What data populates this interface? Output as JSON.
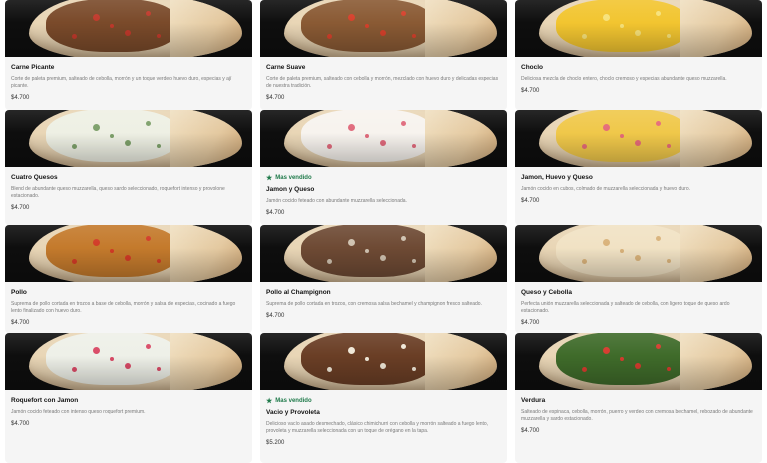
{
  "products": [
    {
      "name": "Carne Picante",
      "description": "Corte de paleta premium, salteado de cebolla, morrón y un toque verdeo huevo duro, especias y ají picante.",
      "price": "$4.700",
      "badge": "",
      "filling": "#7a4a2a",
      "accent": "#c0392b"
    },
    {
      "name": "Carne Suave",
      "description": "Corte de paleta premium, salteado con cebolla y morrón, mezclado con huevo duro y delicadas especias de nuestra tradición.",
      "price": "$4.700",
      "badge": "",
      "filling": "#8a5a34",
      "accent": "#d6402b"
    },
    {
      "name": "Choclo",
      "description": "Deliciosa mezcla de choclo entero, choclo cremoso y especias abundante queso muzzarella.",
      "price": "$4.700",
      "badge": "",
      "filling": "#f2c530",
      "accent": "#f7e27a"
    },
    {
      "name": "Cuatro Quesos",
      "description": "Blend de abundante queso muzzarella, queso sardo seleccionado, roquefort intenso y provolone estacionado.",
      "price": "$4.700",
      "badge": "",
      "filling": "#eef0e4",
      "accent": "#7da06a"
    },
    {
      "name": "Jamon y Queso",
      "description": "Jamón cocido feteado con abundante muzzarella seleccionada.",
      "price": "$4.700",
      "badge": "Mas vendido",
      "filling": "#f7f3ee",
      "accent": "#e06a7c"
    },
    {
      "name": "Jamon, Huevo y Queso",
      "description": "Jamón cocido en cubos, colmado de muzzarella seleccionada y huevo duro.",
      "price": "$4.700",
      "badge": "",
      "filling": "#f0c84a",
      "accent": "#e56b78"
    },
    {
      "name": "Pollo",
      "description": "Suprema de pollo cortada en trozos a base de cebolla, morrón y salsa de especias, cocinado a fuego lento finalizado con huevo duro.",
      "price": "$4.700",
      "badge": "",
      "filling": "#c47a2c",
      "accent": "#d13a26"
    },
    {
      "name": "Pollo al Champignon",
      "description": "Suprema de pollo cortada en trozos, con cremosa salsa bechamel y champignon fresco salteado.",
      "price": "$4.700",
      "badge": "",
      "filling": "#6e4a34",
      "accent": "#cfc2b0"
    },
    {
      "name": "Queso y Cebolla",
      "description": "Perfecta unión muzzarella seleccionada y salteado de cebolla, con ligero toque de queso ardo estacionado.",
      "price": "$4.700",
      "badge": "",
      "filling": "#f1e2c4",
      "accent": "#d9b27a"
    },
    {
      "name": "Roquefort con Jamon",
      "description": "Jamón cocido feteado con intenso queso roquefort premium.",
      "price": "$4.700",
      "badge": "",
      "filling": "#eef0e8",
      "accent": "#d94a66"
    },
    {
      "name": "Vacio y Provoleta",
      "description": "Delicioso vacío asado desmechado, clásico chimichurri con cebolla y morrón salteado a fuego lento, provoleta y muzzarella seleccionada con un toque de orégano en la tapa.",
      "price": "$5.200",
      "badge": "Mas vendido",
      "filling": "#6a3e25",
      "accent": "#f0e8d8"
    },
    {
      "name": "Verdura",
      "description": "Salteado de espinaca, cebolla, morrón, puerro y verdeo con cremosa bechamel, rebozado de abundante muzzarella y sardo estacionado.",
      "price": "$4.700",
      "badge": "",
      "filling": "#3f6b2a",
      "accent": "#d63b2e"
    }
  ]
}
